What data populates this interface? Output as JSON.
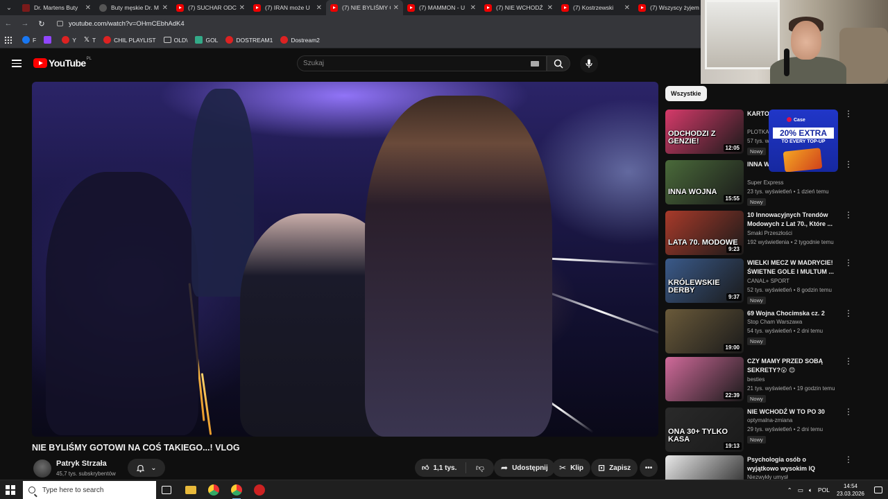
{
  "browser": {
    "tabs": [
      {
        "title": "Dr. Martens Buty",
        "favicon": "drmartens-icon"
      },
      {
        "title": "Buty męskie Dr. M",
        "favicon": "shoe-store-icon"
      },
      {
        "title": "(7) SUCHAR ODC",
        "favicon": "youtube-icon"
      },
      {
        "title": "(7) IRAN może U",
        "favicon": "youtube-icon"
      },
      {
        "title": "(7) NIE BYLIŚMY G",
        "favicon": "youtube-icon",
        "active": true
      },
      {
        "title": "(7) MAMMON - U",
        "favicon": "youtube-icon"
      },
      {
        "title": "(7) NIE WCHODŹ",
        "favicon": "youtube-icon"
      },
      {
        "title": "(7) Kostrzewski",
        "favicon": "youtube-icon"
      },
      {
        "title": "(7) Wszyscy żyjem",
        "favicon": "youtube-icon"
      }
    ],
    "url": "youtube.com/watch?v=OHmCEbhAdK4",
    "bookmarks": [
      {
        "label": "F",
        "icon": "facebook-icon"
      },
      {
        "label": "",
        "icon": "twitch-icon"
      },
      {
        "label": "Y",
        "icon": "youtube-icon"
      },
      {
        "label": "T",
        "icon": "x-icon"
      },
      {
        "label": "CHIL PLAYLIST",
        "icon": "youtube-icon"
      },
      {
        "label": "OLD\\",
        "icon": "folder-icon"
      },
      {
        "label": "GOL",
        "icon": "gol-icon"
      },
      {
        "label": "DOSTREAM1",
        "icon": "youtube-icon"
      },
      {
        "label": "Dostream2",
        "icon": "youtube-icon"
      }
    ]
  },
  "youtube": {
    "logo_text": "YouTube",
    "logo_country": "PL",
    "search_placeholder": "Szukaj",
    "filter_chip": "Wszystkie"
  },
  "video": {
    "title": "NIE BYLIŚMY GOTOWI NA COŚ TAKIEGO...! VLOG",
    "channel": "Patryk Strzała",
    "subscribers": "45,7 tys. subskrybentów",
    "likes": "1,1 tys.",
    "share_label": "Udostępnij",
    "clip_label": "Klip",
    "save_label": "Zapisz"
  },
  "recommendations": [
    {
      "title": "KARTO OPUŚC",
      "channel": "PLOTKA",
      "meta": "57 tys. w",
      "badge": "Nowy",
      "duration": "12:05",
      "thumb_caption": "ODCHODZI Z GENZIE!",
      "thumb_color": "#d63a6a"
    },
    {
      "title": "INNA W UKRAIN",
      "channel": "Super Express",
      "meta": "23 tys. wyświetleń • 1 dzień temu",
      "badge": "Nowy",
      "duration": "15:55",
      "thumb_caption": "INNA WOJNA",
      "thumb_color": "#4a6a3a"
    },
    {
      "title": "10 Innowacyjnych Trendów Modowych z Lat 70., Które ...",
      "channel": "Smaki Przeszłości",
      "meta": "192 wyświetlenia • 2 tygodnie temu",
      "badge": "",
      "duration": "9:23",
      "thumb_caption": "LATA 70. MODOWE",
      "thumb_color": "#a83a2a"
    },
    {
      "title": "WIELKI MECZ W MADRYCIE! ŚWIETNE GOLE I MULTUM ...",
      "channel": "CANAL+ SPORT",
      "meta": "52 tys. wyświetleń • 8 godzin temu",
      "badge": "Nowy",
      "duration": "9:37",
      "thumb_caption": "KRÓLEWSKIE DERBY",
      "thumb_color": "#3a5a8a"
    },
    {
      "title": "69 Wojna Chocimska cz. 2",
      "channel": "Stop Cham Warszawa",
      "meta": "54 tys. wyświetleń • 2 dni temu",
      "badge": "Nowy",
      "duration": "19:00",
      "thumb_caption": "",
      "thumb_color": "#6a5a3a",
      "single": true
    },
    {
      "title": "CZY MAMY PRZED SOBĄ SEKRETY?😮 😊",
      "channel": "besties",
      "meta": "21 tys. wyświetleń • 19 godzin temu",
      "badge": "Nowy",
      "duration": "22:39",
      "thumb_caption": "",
      "thumb_color": "#d06a9a"
    },
    {
      "title": "NIE WCHODŹ W TO PO 30",
      "channel": "optymalna-zmiana",
      "meta": "29 tys. wyświetleń • 2 dni temu",
      "badge": "Nowy",
      "duration": "19:13",
      "thumb_caption": "ONA 30+ TYLKO KASA",
      "thumb_color": "#2a2a2a",
      "single": true
    },
    {
      "title": "Psychologia osób o wyjątkowo wysokim IQ",
      "channel": "Niezwykły umysł",
      "meta": "",
      "badge": "",
      "duration": "",
      "thumb_caption": "",
      "thumb_color": "#e8e8e8"
    }
  ],
  "ad": {
    "brand": "Case",
    "headline": "20% EXTRA",
    "sub": "TO EVERY TOP-UP"
  },
  "taskbar": {
    "search_placeholder": "Type here to search",
    "language": "POL",
    "time": "14:54",
    "date": "23.03.2026"
  },
  "colors": {
    "background": "#0f0f0f",
    "accent": "#ff0000"
  }
}
